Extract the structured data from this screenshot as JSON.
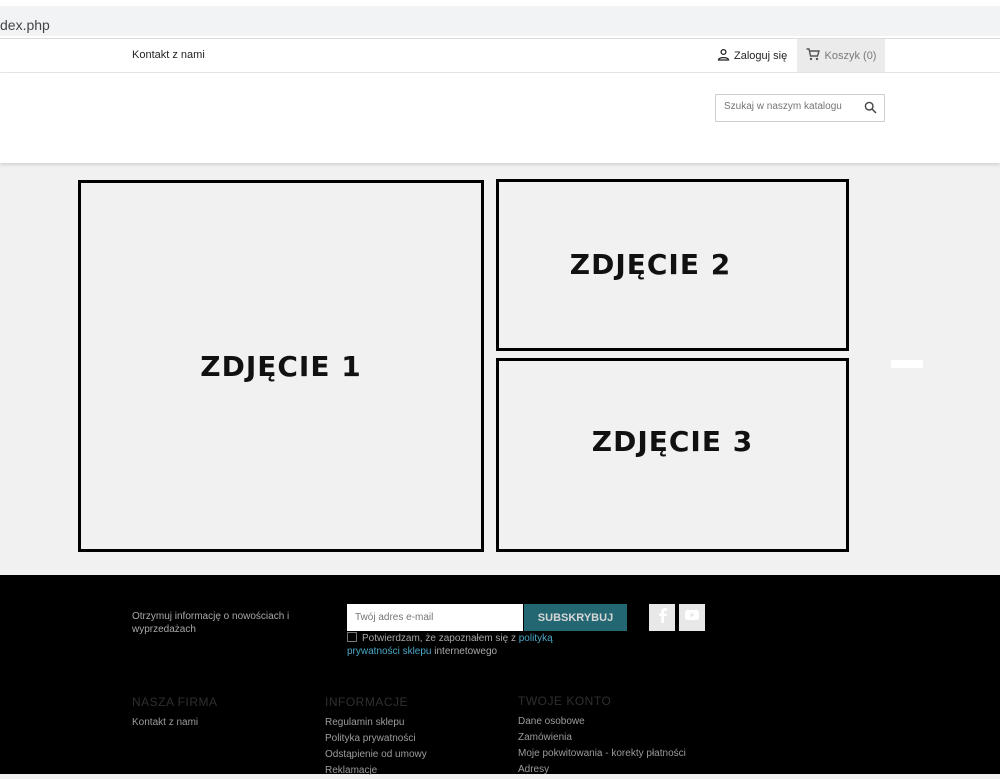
{
  "browser": {
    "url": "dex.php"
  },
  "topnav": {
    "contact": "Kontakt z nami",
    "login": "Zaloguj się",
    "cart": "Koszyk (0)"
  },
  "header": {
    "search_placeholder": "Szukaj w naszym katalogu"
  },
  "tiles": [
    "ZDJĘCIE 1",
    "ZDJĘCIE 2",
    "ZDJĘCIE 3"
  ],
  "footer": {
    "newsletter_text": "Otrzymuj informację o nowościach i wyprzedażach",
    "email_placeholder": "Twój adres e-mail",
    "subscribe": "SUBSKRYBUJ",
    "consent_before": "Potwierdzam, że zapoznałem się z ",
    "consent_link": "polityką prywatności sklepu",
    "consent_after": " internetowego",
    "columns": [
      {
        "title": "NASZA FIRMA",
        "links": [
          "Kontakt z nami"
        ]
      },
      {
        "title": "INFORMACJE",
        "links": [
          "Regulamin sklepu",
          "Polityka prywatności",
          "Odstąpienie od umowy",
          "Reklamacje"
        ]
      },
      {
        "title": "TWOJE KONTO",
        "links": [
          "Dane osobowe",
          "Zamówienia",
          "Moje pokwitowania - korekty płatności",
          "Adresy"
        ]
      }
    ]
  },
  "icons": {
    "user": "user-icon",
    "cart": "cart-icon",
    "search": "search-icon",
    "facebook": "facebook-icon",
    "youtube": "youtube-icon"
  }
}
